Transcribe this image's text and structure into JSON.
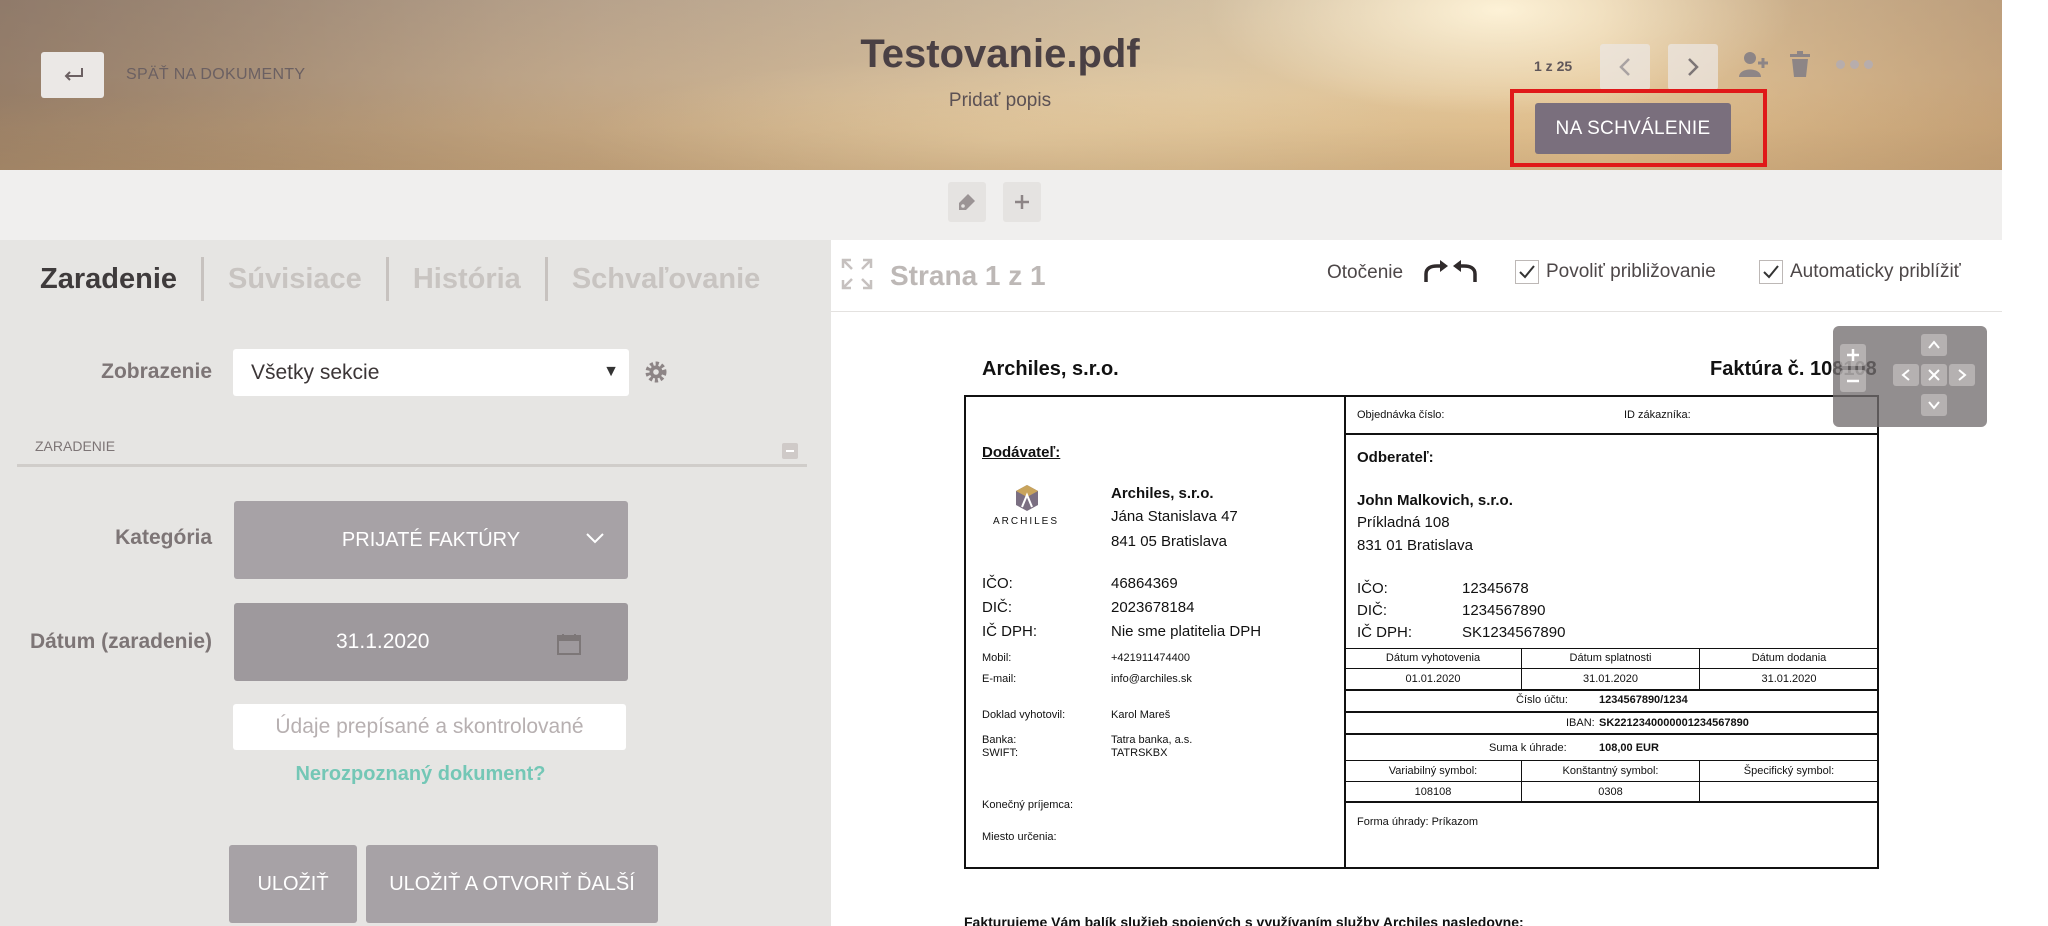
{
  "header": {
    "back_label": "SPÄŤ NA DOKUMENTY",
    "doc_title": "Testovanie.pdf",
    "doc_description": "Pridať popis",
    "page_counter": "1 z 25",
    "approve_label": "NA SCHVÁLENIE"
  },
  "tabs": [
    {
      "label": "Zaradenie",
      "active": true
    },
    {
      "label": "Súvisiace",
      "active": false
    },
    {
      "label": "História",
      "active": false
    },
    {
      "label": "Schvaľovanie",
      "active": false
    }
  ],
  "form": {
    "view_label": "Zobrazenie",
    "view_value": "Všetky sekcie",
    "section_title": "ZARADENIE",
    "category_label": "Kategória",
    "category_value": "PRIJATÉ FAKTÚRY",
    "date_label": "Dátum (zaradenie)",
    "date_value": "31.1.2020",
    "verified_label": "Údaje prepísané a skontrolované",
    "unrecognized_link": "Nerozpoznaný dokument?",
    "save_label": "ULOŽIŤ",
    "save_next_label": "ULOŽIŤ A OTVORIŤ ĎALŠÍ"
  },
  "viewer": {
    "page_indicator": "Strana 1 z 1",
    "rotation_label": "Otočenie",
    "allow_zoom_label": "Povoliť približovanie",
    "allow_zoom_checked": true,
    "auto_zoom_label": "Automaticky priblížiť",
    "auto_zoom_checked": true
  },
  "invoice": {
    "company": "Archiles, s.r.o.",
    "title": "Faktúra č. 108108",
    "order_no_label": "Objednávka číslo:",
    "customer_id_label": "ID zákazníka:",
    "supplier_label": "Dodávateľ:",
    "logo_text": "ARCHILES",
    "supplier_name": "Archiles, s.r.o.",
    "supplier_street": "Jána Stanislava 47",
    "supplier_city": "841 05 Bratislava",
    "ico_label": "IČO:",
    "dic_label": "DIČ:",
    "icdph_label": "IČ DPH:",
    "supplier_ico": "46864369",
    "supplier_dic": "2023678184",
    "supplier_icdph": "Nie sme platitelia DPH",
    "mobile_label": "Mobil:",
    "mobile": "+421911474400",
    "email_label": "E-mail:",
    "email": "info@archiles.sk",
    "issued_by_label": "Doklad vyhotovil:",
    "issued_by": "Karol Mareš",
    "bank_label": "Banka:",
    "swift_label": "SWIFT:",
    "bank": "Tatra banka, a.s.",
    "swift": "TATRSKBX",
    "final_recipient_label": "Konečný príjemca:",
    "destination_label": "Miesto určenia:",
    "buyer_label": "Odberateľ:",
    "buyer_name": "John Malkovich, s.r.o.",
    "buyer_street": "Príkladná 108",
    "buyer_city": "831 01 Bratislava",
    "buyer_ico": "12345678",
    "buyer_dic": "1234567890",
    "buyer_icdph": "SK1234567890",
    "date_issue_label": "Dátum vyhotovenia",
    "date_due_label": "Dátum splatnosti",
    "date_delivery_label": "Dátum dodania",
    "date_issue": "01.01.2020",
    "date_due": "31.01.2020",
    "date_delivery": "31.01.2020",
    "account_label": "Číslo účtu:",
    "account": "1234567890/1234",
    "iban_label": "IBAN:",
    "iban": "SK2212340000001234567890",
    "amount_label": "Suma k úhrade:",
    "amount": "108,00 EUR",
    "var_symbol_label": "Variabilný symbol:",
    "const_symbol_label": "Konštantný symbol:",
    "spec_symbol_label": "Špecifický symbol:",
    "var_symbol": "108108",
    "const_symbol": "0308",
    "payment_method": "Forma úhrady: Príkazom",
    "footer_text": "Fakturujeme Vám balík služieb spojených s využívaním služby Archiles nasledovne:"
  },
  "colors": {
    "approve_button": "#7a6f7d",
    "highlight_frame": "#e01919",
    "link_teal": "#74c7b6",
    "category_button": "#a7a2a6"
  }
}
